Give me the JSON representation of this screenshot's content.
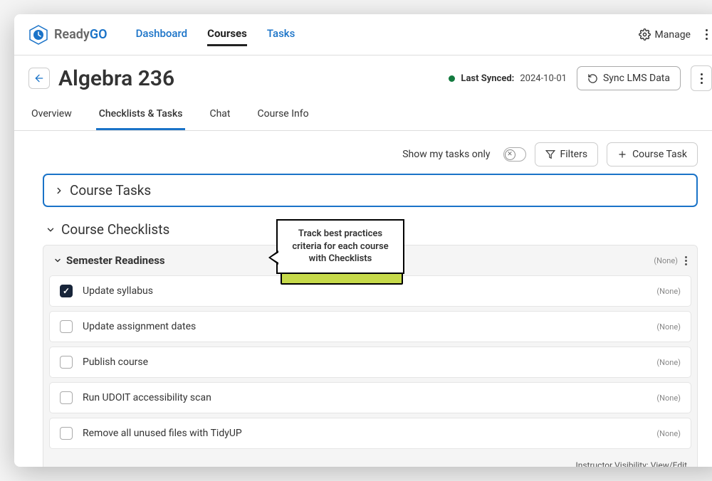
{
  "brand": {
    "name_a": "Ready",
    "name_b": "GO"
  },
  "nav": {
    "dashboard": "Dashboard",
    "courses": "Courses",
    "tasks": "Tasks"
  },
  "topbar": {
    "manage": "Manage"
  },
  "header": {
    "title": "Algebra 236",
    "synced_label": "Last Synced:",
    "synced_date": "2024-10-01",
    "sync_button": "Sync LMS Data"
  },
  "subtabs": {
    "overview": "Overview",
    "checklists": "Checklists & Tasks",
    "chat": "Chat",
    "course_info": "Course Info"
  },
  "toolbar": {
    "show_my_tasks": "Show my tasks only",
    "filters": "Filters",
    "course_task": "Course Task"
  },
  "sections": {
    "course_tasks": "Course Tasks",
    "course_checklists": "Course Checklists"
  },
  "checklist": {
    "group_title": "Semester Readiness",
    "group_tag": "(None)",
    "items": [
      {
        "label": "Update syllabus",
        "checked": true,
        "tag": "(None)"
      },
      {
        "label": "Update assignment dates",
        "checked": false,
        "tag": "(None)"
      },
      {
        "label": "Publish course",
        "checked": false,
        "tag": "(None)"
      },
      {
        "label": "Run UDOIT accessibility scan",
        "checked": false,
        "tag": "(None)"
      },
      {
        "label": "Remove all unused files with TidyUP",
        "checked": false,
        "tag": "(None)"
      }
    ]
  },
  "footer": {
    "visibility": "Instructor Visibility: View/Edit"
  },
  "callout": {
    "text": "Track best practices criteria for each course with Checklists"
  }
}
